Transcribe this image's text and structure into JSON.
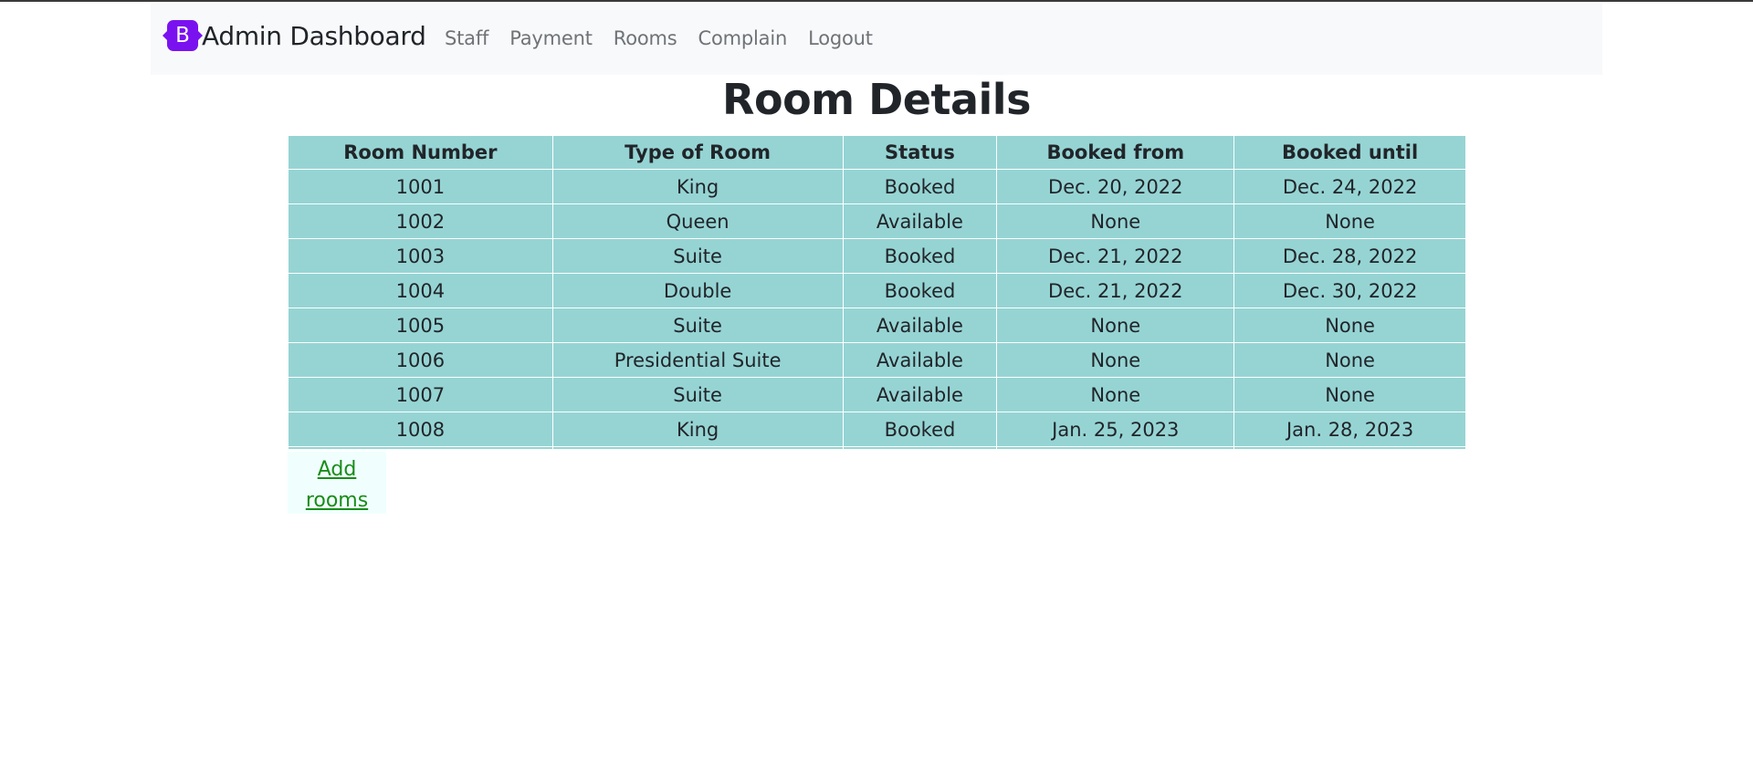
{
  "navbar": {
    "brand_letter": "B",
    "brand_text": "Admin Dashboard",
    "links": [
      "Staff",
      "Payment",
      "Rooms",
      "Complain",
      "Logout"
    ]
  },
  "page": {
    "title": "Room Details",
    "add_link": "Add rooms"
  },
  "table": {
    "headers": [
      "Room Number",
      "Type of Room",
      "Status",
      "Booked from",
      "Booked until"
    ],
    "rows": [
      [
        "1001",
        "King",
        "Booked",
        "Dec. 20, 2022",
        "Dec. 24, 2022"
      ],
      [
        "1002",
        "Queen",
        "Available",
        "None",
        "None"
      ],
      [
        "1003",
        "Suite",
        "Booked",
        "Dec. 21, 2022",
        "Dec. 28, 2022"
      ],
      [
        "1004",
        "Double",
        "Booked",
        "Dec. 21, 2022",
        "Dec. 30, 2022"
      ],
      [
        "1005",
        "Suite",
        "Available",
        "None",
        "None"
      ],
      [
        "1006",
        "Presidential Suite",
        "Available",
        "None",
        "None"
      ],
      [
        "1007",
        "Suite",
        "Available",
        "None",
        "None"
      ],
      [
        "1008",
        "King",
        "Booked",
        "Jan. 25, 2023",
        "Jan. 28, 2023"
      ]
    ]
  },
  "colors": {
    "brand": "#7a12f0",
    "table_bg": "#96d4d4",
    "link": "#198c19",
    "navbar_bg": "#f8f9fa"
  }
}
